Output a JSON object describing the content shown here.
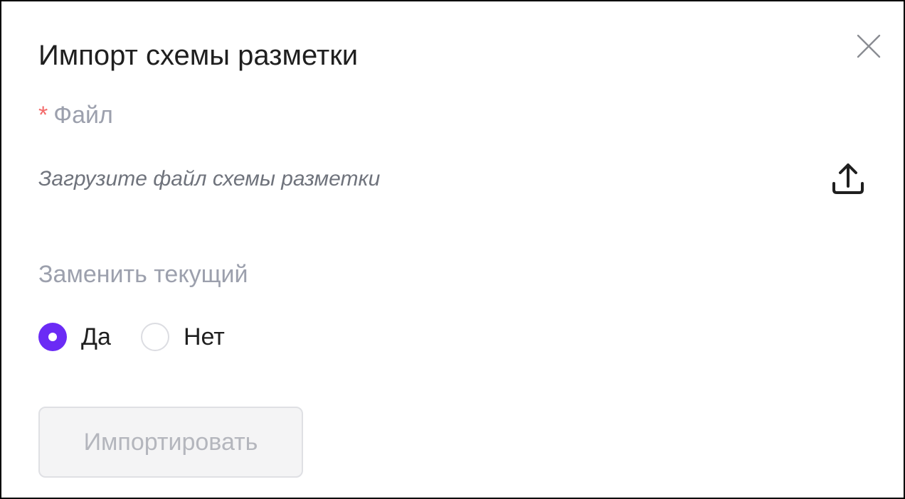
{
  "dialog": {
    "title": "Импорт схемы разметки",
    "close_icon": "close-icon"
  },
  "file_field": {
    "required_mark": "*",
    "label": "Файл",
    "placeholder": "Загрузите файл схемы разметки",
    "upload_icon": "upload-icon"
  },
  "replace_field": {
    "label": "Заменить текущий",
    "options": [
      {
        "label": "Да",
        "checked": true
      },
      {
        "label": "Нет",
        "checked": false
      }
    ]
  },
  "actions": {
    "import_label": "Импортировать",
    "import_disabled": true
  },
  "colors": {
    "accent": "#6b2bf5",
    "required": "#f36a6a",
    "muted_label": "#9ca0ad",
    "disabled_text": "#b4b6bd"
  }
}
